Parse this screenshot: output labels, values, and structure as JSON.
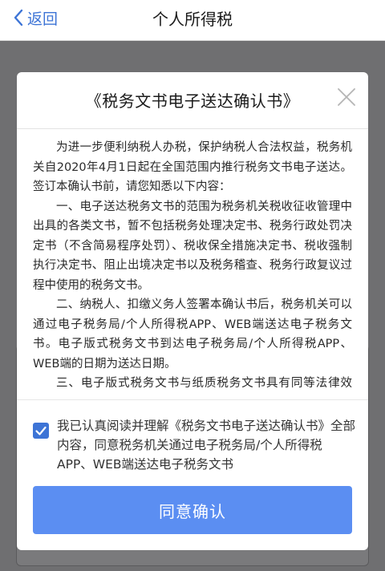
{
  "navbar": {
    "back_label": "返回",
    "title": "个人所得税"
  },
  "modal": {
    "title": "《税务文书电子送达确认书》",
    "paragraphs": [
      "为进一步便利纳税人办税，保护纳税人合法权益，税务机关自2020年4月1日起在全国范围内推行税务文书电子送达。签订本确认书前，请您知悉以下内容：",
      "一、电子送达税务文书的范围为税务机关税收征收管理中出具的各类文书，暂不包括税务处理决定书、税务行政处罚决定书（不含简易程序处罚）、税收保全措施决定书、税收强制执行决定书、阻止出境决定书以及税务稽查、税务行政复议过程中使用的税务文书。",
      "二、纳税人、扣缴义务人签署本确认书后，税务机关可以通过电子税务局/个人所得税APP、WEB端送达电子税务文书。电子版式税务文书到达电子税务局/个人所得税APP、WEB端的日期为送达日期。",
      "三、电子版式税务文书与纸质税务文书具有同等法律效力，纳税人、扣缴义务人需要纸质文书的，可自行下载打印。"
    ],
    "agreement_text": "我已认真阅读并理解《税务文书电子送达确认书》全部内容，同意税务机关通过电子税务局/个人所得税APP、WEB端送达电子税务文书",
    "agreement_checked": true,
    "confirm_label": "同意确认"
  },
  "colors": {
    "accent": "#3d74d6",
    "button": "#5b8ef2",
    "overlay": "#6f6f71"
  }
}
